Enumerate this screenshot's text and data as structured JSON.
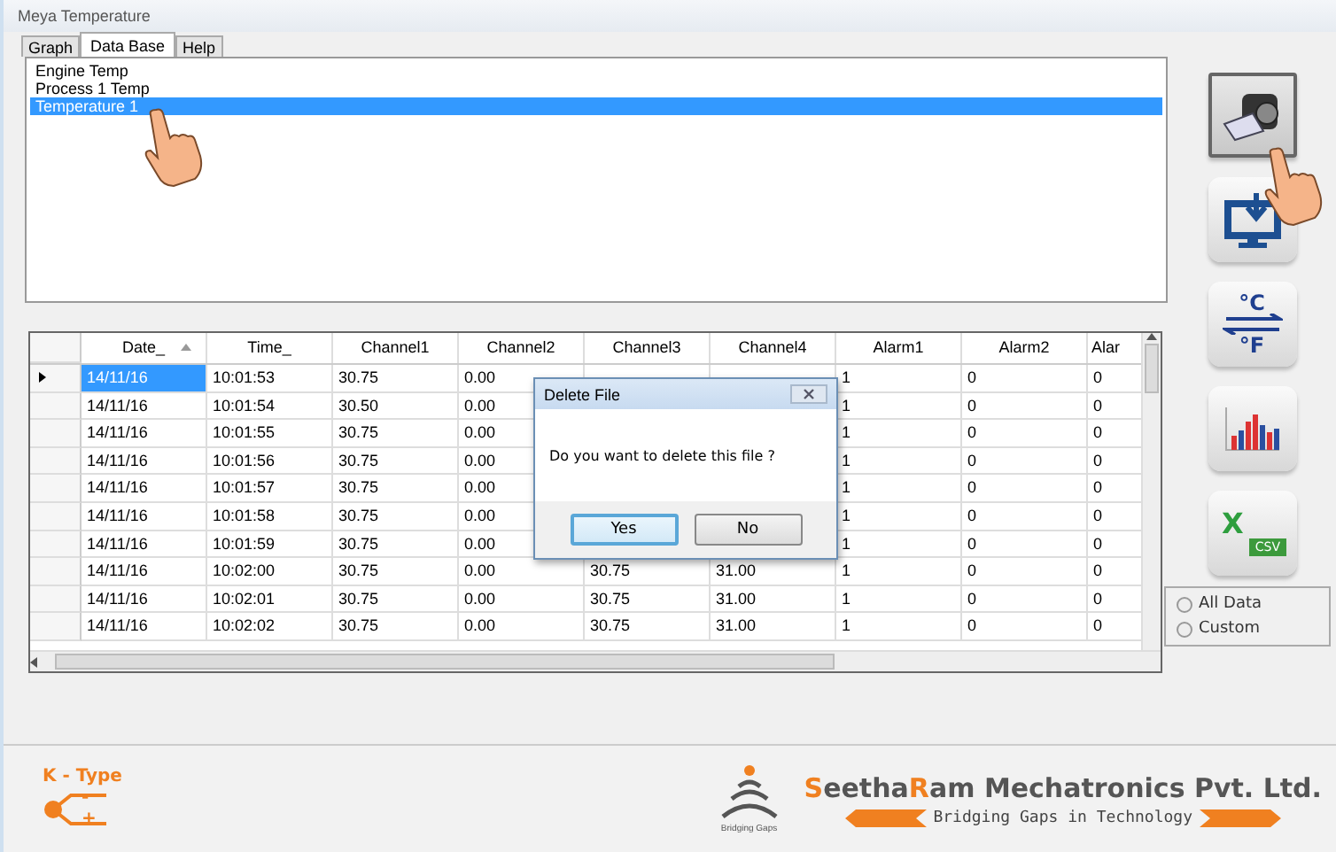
{
  "window": {
    "title": "Meya Temperature"
  },
  "tabs": [
    {
      "label": "Graph",
      "selected": false
    },
    {
      "label": "Data Base",
      "selected": true
    },
    {
      "label": "Help",
      "selected": false
    }
  ],
  "files": [
    {
      "label": "Engine Temp",
      "selected": false
    },
    {
      "label": "Process 1 Temp",
      "selected": false
    },
    {
      "label": "Temperature 1",
      "selected": true
    }
  ],
  "grid": {
    "columns": [
      {
        "label": "Date_",
        "sorted": true
      },
      {
        "label": "Time_",
        "sorted": false
      },
      {
        "label": "Channel1",
        "sorted": false
      },
      {
        "label": "Channel2",
        "sorted": false
      },
      {
        "label": "Channel3",
        "sorted": false
      },
      {
        "label": "Channel4",
        "sorted": false
      },
      {
        "label": "Alarm1",
        "sorted": false
      },
      {
        "label": "Alarm2",
        "sorted": false
      },
      {
        "label": "Alar",
        "sorted": false
      }
    ],
    "rows": [
      {
        "current": true,
        "selected": true,
        "cells": [
          "14/11/16",
          "10:01:53",
          "30.75",
          "0.00",
          null,
          null,
          "1",
          "0",
          "0"
        ]
      },
      {
        "current": false,
        "selected": false,
        "cells": [
          "14/11/16",
          "10:01:54",
          "30.50",
          "0.00",
          null,
          null,
          "1",
          "0",
          "0"
        ]
      },
      {
        "current": false,
        "selected": false,
        "cells": [
          "14/11/16",
          "10:01:55",
          "30.75",
          "0.00",
          null,
          null,
          "1",
          "0",
          "0"
        ]
      },
      {
        "current": false,
        "selected": false,
        "cells": [
          "14/11/16",
          "10:01:56",
          "30.75",
          "0.00",
          null,
          null,
          "1",
          "0",
          "0"
        ]
      },
      {
        "current": false,
        "selected": false,
        "cells": [
          "14/11/16",
          "10:01:57",
          "30.75",
          "0.00",
          null,
          null,
          "1",
          "0",
          "0"
        ]
      },
      {
        "current": false,
        "selected": false,
        "cells": [
          "14/11/16",
          "10:01:58",
          "30.75",
          "0.00",
          null,
          null,
          "1",
          "0",
          "0"
        ]
      },
      {
        "current": false,
        "selected": false,
        "cells": [
          "14/11/16",
          "10:01:59",
          "30.75",
          "0.00",
          null,
          null,
          "1",
          "0",
          "0"
        ]
      },
      {
        "current": false,
        "selected": false,
        "cells": [
          "14/11/16",
          "10:02:00",
          "30.75",
          "0.00",
          "30.75",
          "31.00",
          "1",
          "0",
          "0"
        ]
      },
      {
        "current": false,
        "selected": false,
        "cells": [
          "14/11/16",
          "10:02:01",
          "30.75",
          "0.00",
          "30.75",
          "31.00",
          "1",
          "0",
          "0"
        ]
      },
      {
        "current": false,
        "selected": false,
        "cells": [
          "14/11/16",
          "10:02:02",
          "30.75",
          "0.00",
          "30.75",
          "31.00",
          "1",
          "0",
          "0"
        ]
      }
    ]
  },
  "dialog": {
    "title": "Delete File",
    "message": "Do you want to delete this file ?",
    "buttons": [
      {
        "label": "Yes",
        "focused": true
      },
      {
        "label": "No",
        "focused": false
      }
    ]
  },
  "tools": [
    {
      "kind": "device",
      "pressed": true
    },
    {
      "kind": "import",
      "pressed": false
    },
    {
      "kind": "units",
      "labels": [
        "°C",
        "°F"
      ],
      "pressed": false
    },
    {
      "kind": "chart",
      "pressed": false
    },
    {
      "kind": "excel",
      "labels": [
        "X",
        "CSV"
      ],
      "pressed": false
    }
  ],
  "export_range": [
    {
      "label": "All Data",
      "selected": false
    },
    {
      "label": "Custom",
      "selected": false
    }
  ],
  "footer": {
    "sensor_label": "K - Type",
    "sensor_signs": [
      "-",
      "+"
    ],
    "logo_caption": "Bridging Gaps",
    "company": [
      {
        "text": "S",
        "accent": true
      },
      {
        "text": "eetha",
        "accent": false
      },
      {
        "text": "R",
        "accent": true
      },
      {
        "text": "am Mechatronics Pvt. Ltd.",
        "accent": false
      }
    ],
    "tagline": "Bridging Gaps in Technology"
  }
}
